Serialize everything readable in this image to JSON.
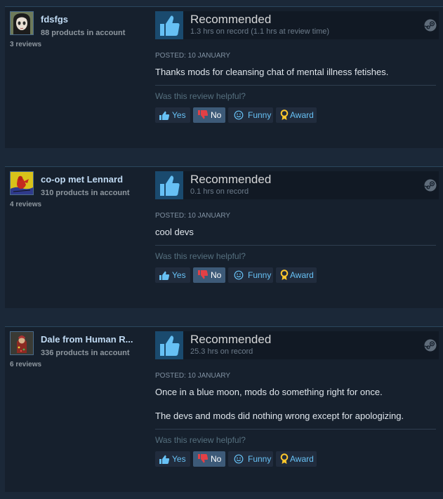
{
  "colors": {
    "page_bg": "#1b2838",
    "review_bg": "#16202d",
    "link_blue": "#67c1f5",
    "thumb_blue": "#1a4a6e",
    "no_selected": "#3d5a78"
  },
  "icons": {
    "thumb": "thumbs-up-icon",
    "steam": "steam-logo-icon",
    "yes": "thumbs-up-icon",
    "no": "thumbs-down-icon",
    "funny": "smiley-icon",
    "award": "award-ribbon-icon"
  },
  "reviews": [
    {
      "author": {
        "name": "fdsfgs",
        "products": "88 products in account",
        "reviews": "3 reviews"
      },
      "vote": {
        "title": "Recommended",
        "hours": "1.3 hrs on record (1.1 hrs at review time)"
      },
      "posted": "Posted: 10 January",
      "body": [
        "Thanks mods for cleansing chat of mental illness fetishes."
      ],
      "helpful_question": "Was this review helpful?",
      "buttons": {
        "yes": "Yes",
        "no": "No",
        "funny": "Funny",
        "award": "Award"
      }
    },
    {
      "author": {
        "name": "co-op met Lennard",
        "products": "310 products in account",
        "reviews": "4 reviews"
      },
      "vote": {
        "title": "Recommended",
        "hours": "0.1 hrs on record"
      },
      "posted": "Posted: 10 January",
      "body": [
        "cool devs"
      ],
      "helpful_question": "Was this review helpful?",
      "buttons": {
        "yes": "Yes",
        "no": "No",
        "funny": "Funny",
        "award": "Award"
      }
    },
    {
      "author": {
        "name": "Dale from Human R...",
        "products": "336 products in account",
        "reviews": "6 reviews"
      },
      "vote": {
        "title": "Recommended",
        "hours": "25.3 hrs on record"
      },
      "posted": "Posted: 10 January",
      "body": [
        "Once in a blue moon, mods do something right for once.",
        "The devs and mods did nothing wrong except for apologizing."
      ],
      "helpful_question": "Was this review helpful?",
      "buttons": {
        "yes": "Yes",
        "no": "No",
        "funny": "Funny",
        "award": "Award"
      }
    }
  ]
}
